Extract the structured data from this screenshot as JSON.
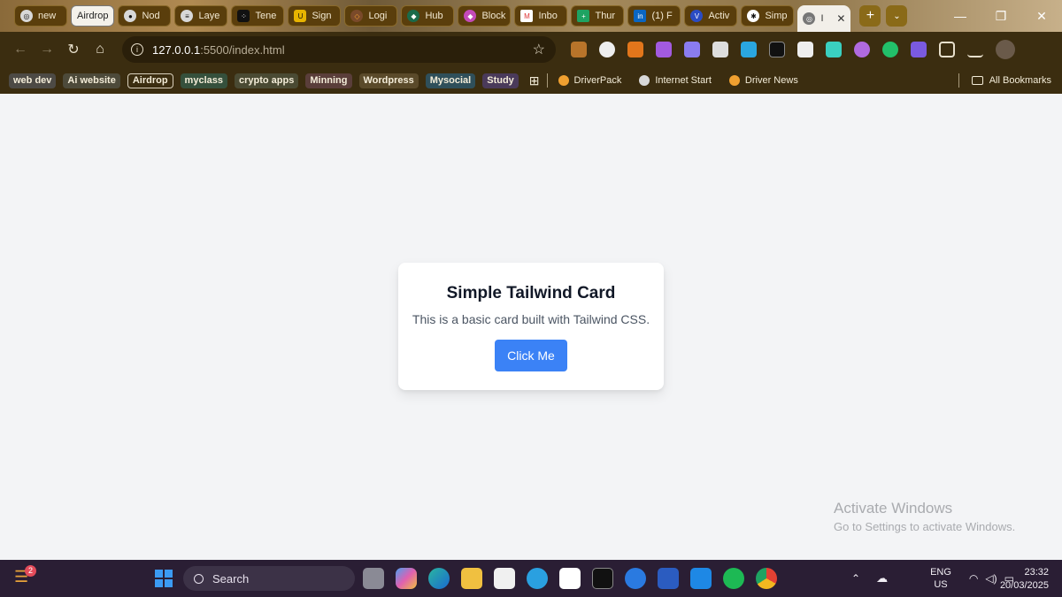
{
  "tabs": [
    {
      "label": "new",
      "icon": "globe-icon"
    },
    {
      "label": "Airdrop",
      "group": true
    },
    {
      "label": "Nod",
      "icon": "app-icon"
    },
    {
      "label": "Laye",
      "icon": "app-icon"
    },
    {
      "label": "Tene",
      "icon": "app-icon"
    },
    {
      "label": "Sign",
      "icon": "app-icon"
    },
    {
      "label": "Logi",
      "icon": "app-icon"
    },
    {
      "label": "Hub",
      "icon": "app-icon"
    },
    {
      "label": "Block",
      "icon": "app-icon"
    },
    {
      "label": "Inbo",
      "icon": "gmail-icon"
    },
    {
      "label": "Thur",
      "icon": "sheets-icon"
    },
    {
      "label": "(1) F",
      "icon": "linkedin-icon"
    },
    {
      "label": "Activ",
      "icon": "app-icon"
    },
    {
      "label": "Simp",
      "icon": "chatgpt-icon"
    },
    {
      "label": "I",
      "icon": "globe-icon",
      "active": true
    }
  ],
  "toolbar": {
    "url_host": "127.0.0.1",
    "url_path": ":5500/index.html"
  },
  "bookmarks": {
    "folders": [
      {
        "label": "web dev",
        "color": "#4d4a45"
      },
      {
        "label": "Ai website",
        "color": "#4d4a3a"
      },
      {
        "label": "Airdrop",
        "color": "#3b2d10",
        "outlined": true
      },
      {
        "label": "myclass",
        "color": "#35503c"
      },
      {
        "label": "crypto apps",
        "color": "#4a4a33"
      },
      {
        "label": "Minning",
        "color": "#5a3e3a"
      },
      {
        "label": "Wordpress",
        "color": "#5a4a2a"
      },
      {
        "label": "Mysocial",
        "color": "#2f4f5a"
      },
      {
        "label": "Study",
        "color": "#4a3a5a"
      }
    ],
    "links": [
      {
        "label": "DriverPack",
        "color": "#f0a030"
      },
      {
        "label": "Internet Start",
        "color": "#d8d8d8"
      },
      {
        "label": "Driver News",
        "color": "#f0a030"
      }
    ],
    "all_bookmarks": "All Bookmarks"
  },
  "card": {
    "title": "Simple Tailwind Card",
    "text": "This is a basic card built with Tailwind CSS.",
    "button": "Click Me"
  },
  "watermark": {
    "line1": "Activate Windows",
    "line2": "Go to Settings to activate Windows."
  },
  "taskbar": {
    "notification_count": "2",
    "search_label": "Search",
    "lang_line1": "ENG",
    "lang_line2": "US",
    "time": "23:32",
    "date": "20/03/2025"
  },
  "colors": {
    "accent_button": "#3b82f6",
    "page_background": "#f3f4f6"
  }
}
